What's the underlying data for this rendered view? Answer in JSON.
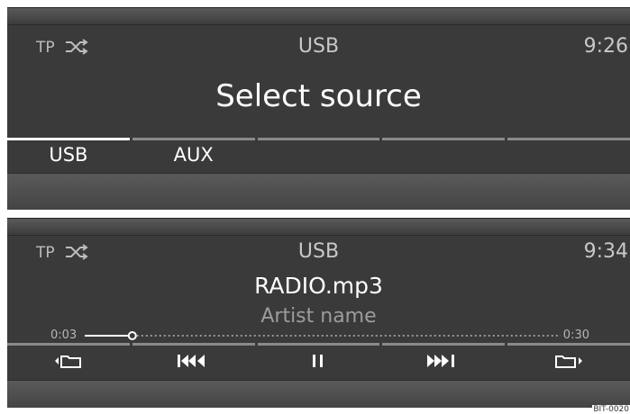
{
  "screen1": {
    "tp": "TP",
    "source": "USB",
    "time": "9:26",
    "title": "Select source",
    "tabs": [
      "USB",
      "AUX",
      "",
      "",
      ""
    ]
  },
  "screen2": {
    "tp": "TP",
    "source": "USB",
    "time": "9:34",
    "track": "RADIO.mp3",
    "artist": "Artist name",
    "elapsed": "0:03",
    "total": "0:30",
    "progress_fraction": 0.1,
    "buttons": [
      "folder-back-icon",
      "previous-track-icon",
      "pause-icon",
      "next-track-icon",
      "folder-forward-icon"
    ]
  },
  "figure_code": "BIT-0020"
}
